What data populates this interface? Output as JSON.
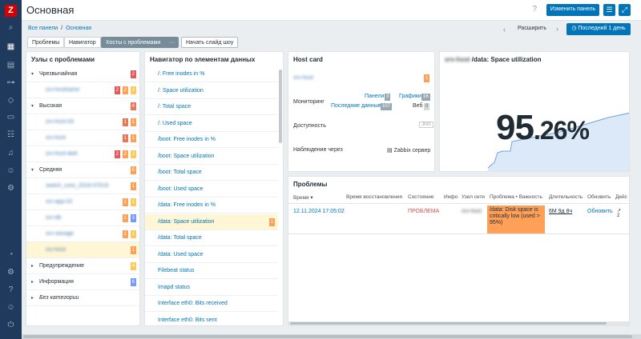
{
  "app": {
    "logo": "Z",
    "title": "Основная",
    "help": "?",
    "edit_label": "Изменить панель"
  },
  "breadcrumb": {
    "all": "Все панели",
    "sep": "/",
    "current": "Основная"
  },
  "tabs": [
    {
      "label": "Проблемы"
    },
    {
      "label": "Навигатор"
    },
    {
      "label": "Хосты с проблемами"
    },
    {
      "label": "···"
    },
    {
      "label": "Начать слайд шоу"
    }
  ],
  "nav": {
    "expand": "Расширить",
    "range": "Последний 1 день"
  },
  "hosts_panel": {
    "title": "Узлы с проблемами",
    "groups": [
      {
        "label": "Чрезвычайная",
        "count": "2",
        "hosts": [
          {
            "name": "srv-hostname",
            "b": [
              "2",
              "2",
              "2"
            ]
          }
        ]
      },
      {
        "label": "Высокая",
        "count": "4",
        "hosts": [
          {
            "name": "srv-host-03",
            "b": [
              "1",
              "1"
            ]
          },
          {
            "name": "srv-host",
            "b": [
              "1",
              "1"
            ]
          },
          {
            "name": "srv-host-dwh",
            "b": [
              "2",
              "2",
              "2"
            ]
          }
        ]
      },
      {
        "label": "Средняя",
        "count": "5",
        "hosts": [
          {
            "name": "switch_core_2018-07019",
            "b": [
              "1"
            ]
          },
          {
            "name": "srv-app-02",
            "b": [
              "1",
              "1"
            ]
          },
          {
            "name": "srv-db",
            "b": [
              "1",
              "3"
            ]
          },
          {
            "name": "srv-storage",
            "b": [
              "1",
              "1"
            ]
          },
          {
            "name": "srv-host",
            "b": [
              "1"
            ]
          }
        ]
      },
      {
        "label": "Предупреждение",
        "count": "4",
        "hosts": []
      },
      {
        "label": "Информация",
        "count": "6",
        "hosts": []
      },
      {
        "label": "Без категории",
        "count": "",
        "hosts": []
      }
    ]
  },
  "nav_panel": {
    "title": "Навигатор по элементам данных",
    "items": [
      {
        "label": "/: Free inodes in %"
      },
      {
        "label": "/: Space utilization"
      },
      {
        "label": "/: Total space"
      },
      {
        "label": "/: Used space"
      },
      {
        "label": "/boot: Free inodes in %"
      },
      {
        "label": "/boot: Space utilization"
      },
      {
        "label": "/boot: Total space"
      },
      {
        "label": "/boot: Used space"
      },
      {
        "label": "/data: Free inodes in %"
      },
      {
        "label": "/data: Space utilization",
        "badge": "1"
      },
      {
        "label": "/data: Total space"
      },
      {
        "label": "/data: Used space"
      },
      {
        "label": "Filebeat status"
      },
      {
        "label": "Imapd status"
      },
      {
        "label": "Interface eth0: Bits received"
      },
      {
        "label": "Interface eth0: Bits sent"
      }
    ]
  },
  "host_card": {
    "title": "Host card",
    "host": "srv-host",
    "badge": "1",
    "monitoring_label": "Мониторинг",
    "dashboards": "Панели",
    "dashboards_n": "3",
    "graphs": "Графики",
    "graphs_n": "16",
    "latest": "Последние данные",
    "latest_n": "107",
    "web": "Веб",
    "web_n": "0",
    "availability_label": "Доступность",
    "availability": "JMX",
    "proxy_label": "Наблюдение через",
    "proxy": "Zabbix сервер"
  },
  "gauge": {
    "title_host": "srv-host",
    "title": "/data: Space utilization",
    "value_int": "95",
    "value_dec": ".26",
    "unit": "%"
  },
  "problems": {
    "title": "Проблемы",
    "cols": [
      "Время",
      "Время восстановления",
      "Состояние",
      "Инфо",
      "Узел сети",
      "Проблема • Важность",
      "Длительность",
      "Обновить",
      "Дейс"
    ],
    "row": {
      "time": "12.11.2024 17:05:02",
      "status": "ПРОБЛЕМА",
      "host": "srv-host",
      "problem": "/data: Disk space is critically low (used > 95%)",
      "duration": "6М 9д 8ч",
      "update": "Обновить",
      "actions": "2"
    }
  },
  "colors": {
    "disaster": "#e45959",
    "high": "#e97659",
    "average": "#ffa059",
    "warning": "#ffc859",
    "info": "#7499ff",
    "nc": "#97aab3",
    "accent": "#0275b8"
  }
}
